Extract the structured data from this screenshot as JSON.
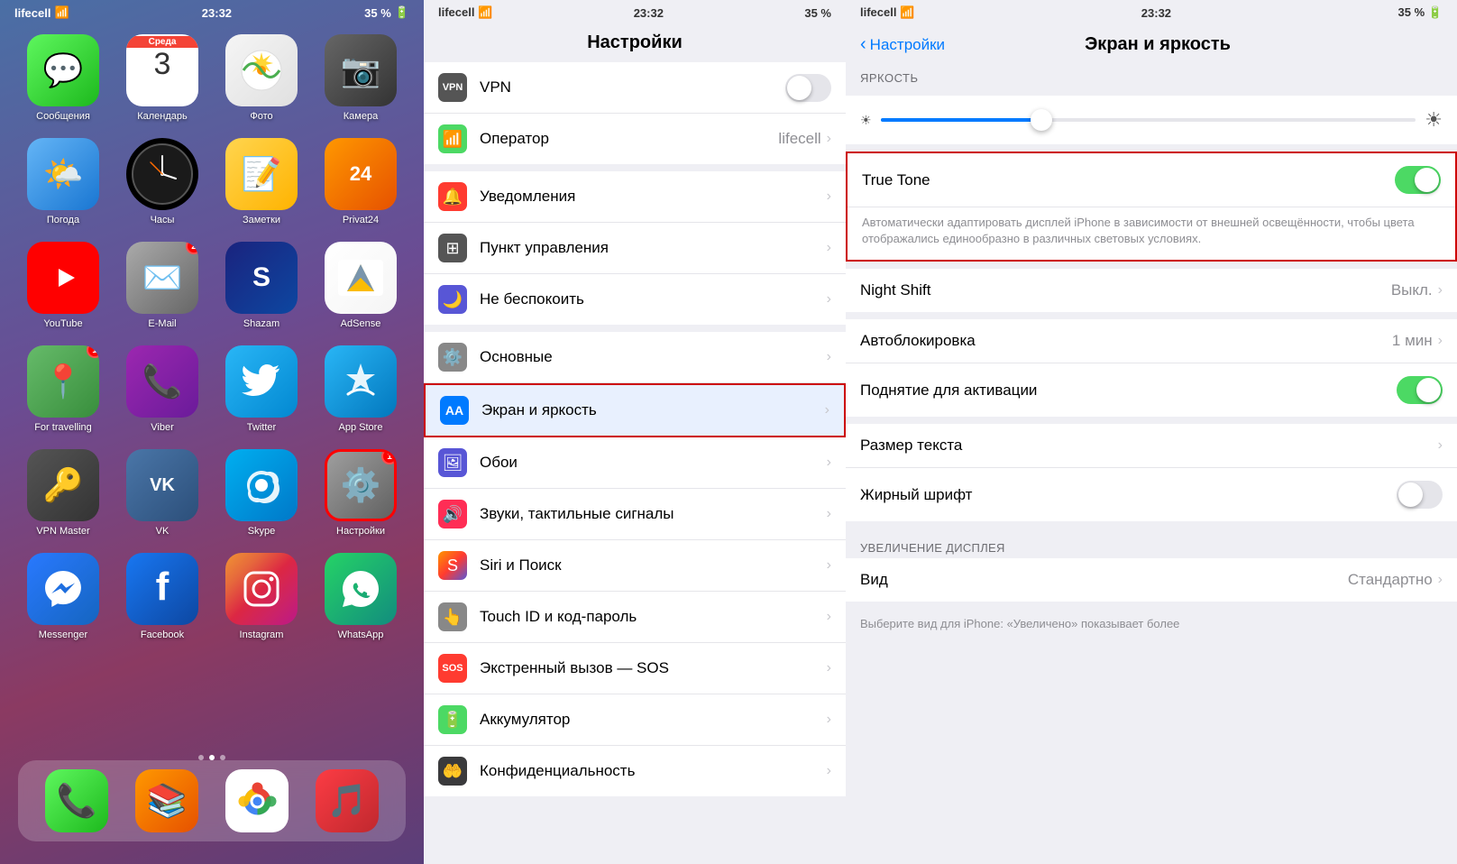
{
  "home": {
    "carrier": "lifecell",
    "time": "23:32",
    "battery": "35 %",
    "apps": [
      {
        "id": "messages",
        "label": "Сообщения",
        "bg": "bg-green",
        "icon": "💬",
        "badge": null
      },
      {
        "id": "calendar",
        "label": "Календарь",
        "bg": "bg-red-cal",
        "icon": "cal",
        "badge": null
      },
      {
        "id": "photos",
        "label": "Фото",
        "bg": "bg-photos",
        "icon": "🖼️",
        "badge": null
      },
      {
        "id": "camera",
        "label": "Камера",
        "bg": "bg-gray-cam",
        "icon": "📷",
        "badge": null
      },
      {
        "id": "weather",
        "label": "Погода",
        "bg": "bg-blue-cloud",
        "icon": "🌤️",
        "badge": null
      },
      {
        "id": "clock",
        "label": "Часы",
        "bg": "bg-gray-cam",
        "icon": "🕐",
        "badge": null
      },
      {
        "id": "notes",
        "label": "Заметки",
        "bg": "bg-gray-notes",
        "icon": "📝",
        "badge": null
      },
      {
        "id": "privat24",
        "label": "Privat24",
        "bg": "bg-orange",
        "icon": "24",
        "badge": null
      },
      {
        "id": "youtube",
        "label": "YouTube",
        "bg": "bg-red-yt",
        "icon": "▶",
        "badge": null
      },
      {
        "id": "email",
        "label": "E-Mail",
        "bg": "bg-email",
        "icon": "✉️",
        "badge": "2"
      },
      {
        "id": "shazam",
        "label": "Shazam",
        "bg": "bg-shazam",
        "icon": "S",
        "badge": null
      },
      {
        "id": "adsense",
        "label": "AdSense",
        "bg": "bg-adsense",
        "icon": "▲",
        "badge": null
      },
      {
        "id": "maps",
        "label": "For travelling",
        "bg": "bg-maps",
        "icon": "📍",
        "badge": "1"
      },
      {
        "id": "viber",
        "label": "Viber",
        "bg": "bg-viber",
        "icon": "📞",
        "badge": null
      },
      {
        "id": "twitter",
        "label": "Twitter",
        "bg": "bg-twitter",
        "icon": "🐦",
        "badge": null
      },
      {
        "id": "appstore",
        "label": "App Store",
        "bg": "bg-appstore",
        "icon": "A",
        "badge": null
      },
      {
        "id": "vpnmaster",
        "label": "VPN Master",
        "bg": "bg-vpn",
        "icon": "🔑",
        "badge": null
      },
      {
        "id": "vk",
        "label": "VK",
        "bg": "bg-vk",
        "icon": "VK",
        "badge": null
      },
      {
        "id": "skype",
        "label": "Skype",
        "bg": "bg-skype",
        "icon": "☁",
        "badge": null
      },
      {
        "id": "settings-h",
        "label": "Настройки",
        "bg": "bg-settings-h",
        "icon": "⚙️",
        "badge": "1"
      },
      {
        "id": "messenger",
        "label": "Messenger",
        "bg": "bg-messenger",
        "icon": "💬",
        "badge": null
      },
      {
        "id": "facebook",
        "label": "Facebook",
        "bg": "bg-facebook",
        "icon": "f",
        "badge": null
      },
      {
        "id": "instagram",
        "label": "Instagram",
        "bg": "bg-instagram",
        "icon": "📷",
        "badge": null
      },
      {
        "id": "whatsapp",
        "label": "WhatsApp",
        "bg": "bg-whatsapp",
        "icon": "📱",
        "badge": null
      }
    ],
    "calendar_day": "3",
    "calendar_weekday": "Среда",
    "dock": [
      {
        "id": "phone",
        "icon": "📞",
        "bg": "bg-green"
      },
      {
        "id": "books",
        "icon": "📚",
        "bg": "bg-orange"
      },
      {
        "id": "chrome",
        "icon": "🌐",
        "bg": "bg-blue-cloud"
      },
      {
        "id": "music",
        "icon": "🎵",
        "bg": "bg-red-yt"
      }
    ]
  },
  "settings": {
    "carrier": "lifecell",
    "time": "23:32",
    "battery": "35 %",
    "title": "Настройки",
    "rows": [
      {
        "id": "vpn",
        "label": "VPN",
        "value": "",
        "icon_bg": "#555",
        "icon": "VPN",
        "has_toggle": true,
        "toggle_on": false
      },
      {
        "id": "operator",
        "label": "Оператор",
        "value": "lifecell",
        "icon_bg": "#4cd964",
        "icon": "📶"
      },
      {
        "id": "notifications",
        "label": "Уведомления",
        "value": "",
        "icon_bg": "#ff3b30",
        "icon": "🔔"
      },
      {
        "id": "control",
        "label": "Пункт управления",
        "value": "",
        "icon_bg": "#555",
        "icon": "⊞"
      },
      {
        "id": "dnd",
        "label": "Не беспокоить",
        "value": "",
        "icon_bg": "#5856d6",
        "icon": "🌙"
      },
      {
        "id": "general",
        "label": "Основные",
        "value": "",
        "icon_bg": "#888",
        "icon": "⚙️"
      },
      {
        "id": "display",
        "label": "Экран и яркость",
        "value": "",
        "icon_bg": "#007aff",
        "icon": "AA",
        "highlighted": true
      },
      {
        "id": "wallpaper",
        "label": "Обои",
        "value": "",
        "icon_bg": "#5856d6",
        "icon": "🖼"
      },
      {
        "id": "sounds",
        "label": "Звуки, тактильные сигналы",
        "value": "",
        "icon_bg": "#ff2d55",
        "icon": "🔊"
      },
      {
        "id": "siri",
        "label": "Siri и Поиск",
        "value": "",
        "icon_bg": "#ff9500",
        "icon": "S"
      },
      {
        "id": "touchid",
        "label": "Touch ID и код-пароль",
        "value": "",
        "icon_bg": "#888",
        "icon": "👆"
      },
      {
        "id": "sos",
        "label": "Экстренный вызов — SOS",
        "value": "",
        "icon_bg": "#ff3b30",
        "icon": "SOS"
      },
      {
        "id": "battery",
        "label": "Аккумулятор",
        "value": "",
        "icon_bg": "#4cd964",
        "icon": "🔋"
      },
      {
        "id": "privacy",
        "label": "Конфиденциальность",
        "value": "",
        "icon_bg": "#3a3a3c",
        "icon": "🤲"
      }
    ]
  },
  "display": {
    "carrier": "lifecell",
    "time": "23:32",
    "battery": "35 %",
    "back_label": "Настройки",
    "title": "Экран и яркость",
    "brightness_label": "ЯРКОСТЬ",
    "brightness_pct": 30,
    "truetone_label": "True Tone",
    "truetone_on": true,
    "truetone_desc": "Автоматически адаптировать дисплей iPhone в зависимости от внешней освещённости, чтобы цвета отображались единообразно в различных световых условиях.",
    "night_shift_label": "Night Shift",
    "night_shift_value": "Выкл.",
    "autolock_label": "Автоблокировка",
    "autolock_value": "1 мин",
    "raise_label": "Поднятие для активации",
    "raise_on": true,
    "text_size_label": "Размер текста",
    "bold_label": "Жирный шрифт",
    "bold_on": false,
    "zoom_section_label": "УВЕЛИЧЕНИЕ ДИСПЛЕЯ",
    "zoom_label": "Вид",
    "zoom_value": "Стандартно",
    "zoom_desc": "Выберите вид для iPhone: «Увеличено» показывает более"
  }
}
